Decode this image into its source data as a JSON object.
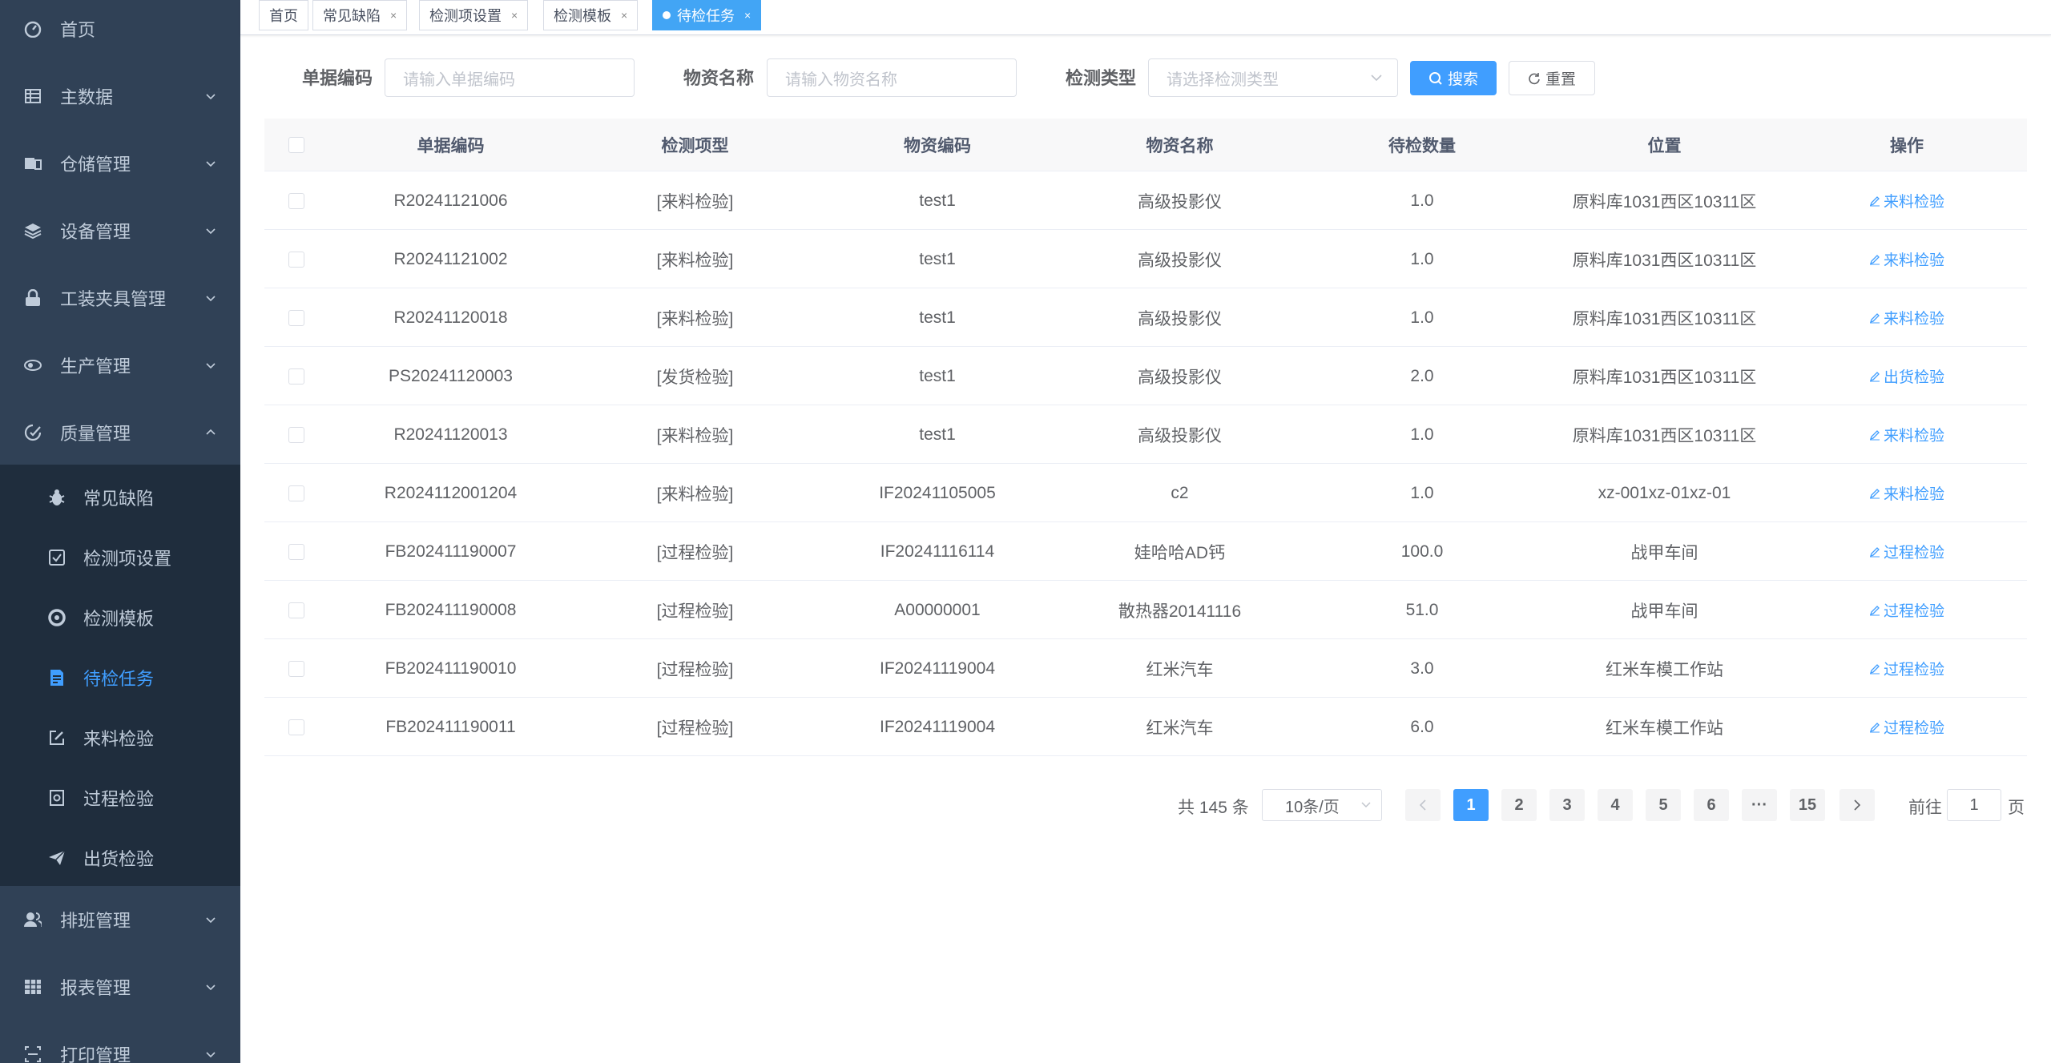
{
  "sidebar": {
    "items": [
      {
        "label": "首页",
        "icon": "dashboard-icon"
      },
      {
        "label": "主数据",
        "icon": "table-icon"
      },
      {
        "label": "仓储管理",
        "icon": "warehouse-icon"
      },
      {
        "label": "设备管理",
        "icon": "layers-icon"
      },
      {
        "label": "工装夹具管理",
        "icon": "lock-icon"
      },
      {
        "label": "生产管理",
        "icon": "eye-icon"
      },
      {
        "label": "质量管理",
        "icon": "quality-icon"
      },
      {
        "label": "排班管理",
        "icon": "peoples-icon"
      },
      {
        "label": "报表管理",
        "icon": "grid-icon"
      },
      {
        "label": "打印管理",
        "icon": "print-icon"
      }
    ],
    "sub_items": [
      {
        "label": "常见缺陷",
        "icon": "bug-icon"
      },
      {
        "label": "检测项设置",
        "icon": "checkbox-icon"
      },
      {
        "label": "检测模板",
        "icon": "template-icon"
      },
      {
        "label": "待检任务",
        "icon": "task-icon"
      },
      {
        "label": "来料检验",
        "icon": "edit-icon"
      },
      {
        "label": "过程检验",
        "icon": "process-icon"
      },
      {
        "label": "出货检验",
        "icon": "send-icon"
      }
    ]
  },
  "tabs": [
    {
      "label": "首页"
    },
    {
      "label": "常见缺陷"
    },
    {
      "label": "检测项设置"
    },
    {
      "label": "检测模板"
    },
    {
      "label": "待检任务"
    }
  ],
  "search": {
    "code_label": "单据编码",
    "code_placeholder": "请输入单据编码",
    "name_label": "物资名称",
    "name_placeholder": "请输入物资名称",
    "type_label": "检测类型",
    "type_placeholder": "请选择检测类型",
    "search_button": "搜索",
    "reset_button": "重置"
  },
  "table": {
    "headers": [
      "单据编码",
      "检测项型",
      "物资编码",
      "物资名称",
      "待检数量",
      "位置",
      "操作"
    ],
    "rows": [
      {
        "code": "R20241121006",
        "type": "[来料检验]",
        "mcode": "test1",
        "mname": "高级投影仪",
        "qty": "1.0",
        "loc": "原料库1031西区10311区",
        "op": "来料检验"
      },
      {
        "code": "R20241121002",
        "type": "[来料检验]",
        "mcode": "test1",
        "mname": "高级投影仪",
        "qty": "1.0",
        "loc": "原料库1031西区10311区",
        "op": "来料检验"
      },
      {
        "code": "R20241120018",
        "type": "[来料检验]",
        "mcode": "test1",
        "mname": "高级投影仪",
        "qty": "1.0",
        "loc": "原料库1031西区10311区",
        "op": "来料检验"
      },
      {
        "code": "PS20241120003",
        "type": "[发货检验]",
        "mcode": "test1",
        "mname": "高级投影仪",
        "qty": "2.0",
        "loc": "原料库1031西区10311区",
        "op": "出货检验"
      },
      {
        "code": "R20241120013",
        "type": "[来料检验]",
        "mcode": "test1",
        "mname": "高级投影仪",
        "qty": "1.0",
        "loc": "原料库1031西区10311区",
        "op": "来料检验"
      },
      {
        "code": "R2024112001204",
        "type": "[来料检验]",
        "mcode": "IF20241105005",
        "mname": "c2",
        "qty": "1.0",
        "loc": "xz-001xz-01xz-01",
        "op": "来料检验"
      },
      {
        "code": "FB202411190007",
        "type": "[过程检验]",
        "mcode": "IF20241116114",
        "mname": "娃哈哈AD钙",
        "qty": "100.0",
        "loc": "战甲车间",
        "op": "过程检验"
      },
      {
        "code": "FB202411190008",
        "type": "[过程检验]",
        "mcode": "A00000001",
        "mname": "散热器20141116",
        "qty": "51.0",
        "loc": "战甲车间",
        "op": "过程检验"
      },
      {
        "code": "FB202411190010",
        "type": "[过程检验]",
        "mcode": "IF20241119004",
        "mname": "红米汽车",
        "qty": "3.0",
        "loc": "红米车模工作站",
        "op": "过程检验"
      },
      {
        "code": "FB202411190011",
        "type": "[过程检验]",
        "mcode": "IF20241119004",
        "mname": "红米汽车",
        "qty": "6.0",
        "loc": "红米车模工作站",
        "op": "过程检验"
      }
    ]
  },
  "pagination": {
    "total": "共 145 条",
    "page_size": "10条/页",
    "pages": [
      "1",
      "2",
      "3",
      "4",
      "5",
      "6",
      "···",
      "15"
    ],
    "current": "1",
    "goto_label": "前往",
    "goto_value": "1",
    "goto_suffix": "页"
  },
  "colors": {
    "sidebar_bg": "#304156",
    "submenu_bg": "#1f2d3d",
    "accent": "#409eff"
  }
}
